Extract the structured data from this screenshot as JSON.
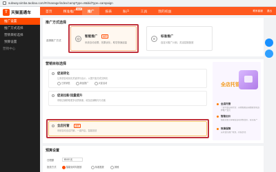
{
  "browser": {
    "url": "subway.simba.taobao.com/#!/manage/index/campType=8&bidType=campaign"
  },
  "brand": {
    "logo": "T",
    "name": "天猫直通车"
  },
  "sidebar": {
    "items": [
      {
        "label": "推广设置"
      },
      {
        "label": "推广方式选择"
      },
      {
        "label": "营销目标选择"
      },
      {
        "label": "预算设置"
      }
    ],
    "section": "营销中心"
  },
  "topnav": {
    "tabs": [
      {
        "label": "首页"
      },
      {
        "label": "精准推广"
      },
      {
        "label": "推广"
      },
      {
        "label": "报表"
      },
      {
        "label": "账户"
      },
      {
        "label": "工具"
      },
      {
        "label": "我的权益"
      }
    ],
    "badge": "NEW",
    "right": [
      "联系客服",
      "退出"
    ]
  },
  "promo_type": {
    "title": "推广方式选择",
    "label": "选择推广方式",
    "cards": [
      {
        "title": "智能推广",
        "tag": "推荐",
        "desc": "系统自动设置，效果优化，助您快速起量"
      },
      {
        "title": "标准推广",
        "desc": "自定义推广计划，灵活控制投放"
      }
    ]
  },
  "marketing_goal": {
    "title": "营销目标选择",
    "goals": [
      {
        "title": "促进转化",
        "desc": "让系统自动优化关键词与出价，以提升宝贝成交转化",
        "opts": [
          "日常销售",
          "新品推广",
          "大促活动"
        ]
      },
      {
        "title": "促进拉新/流量提升",
        "desc": "帮助店铺获取更多优质新客，增加店铺曝光与访客"
      },
      {
        "title": "全店托管",
        "tag": "推荐",
        "desc": "系统自动全店托管，一键开启，智能投放"
      }
    ],
    "side": {
      "headline": "全店托管",
      "tips": [
        {
          "title": "全店托管",
          "desc": "一键开启自动托管，系统根据店铺数据智能选择推广宝贝"
        },
        {
          "title": "智能出价",
          "desc": "根据流量竞争程度自动调整出价，提高投产"
        },
        {
          "title": "效果保障",
          "desc": "实时监控推广效果，持续优化"
        }
      ]
    }
  },
  "budget": {
    "title": "预算设置",
    "daily_label": "日限额",
    "daily_value": "80.00 元",
    "mode_label": "投放方式",
    "options": [
      "智能化均匀投放",
      "标准投放",
      "其他"
    ]
  }
}
